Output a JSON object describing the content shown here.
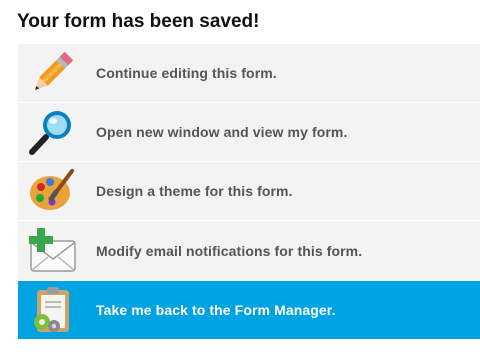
{
  "page": {
    "title": "Your form has been saved!"
  },
  "menu": {
    "items": [
      {
        "label": "Continue editing this form.",
        "icon": "pencil-icon"
      },
      {
        "label": "Open new window and view my form.",
        "icon": "magnifier-icon"
      },
      {
        "label": "Design a theme for this form.",
        "icon": "paint-palette-icon"
      },
      {
        "label": "Modify email notifications for this form.",
        "icon": "email-add-icon"
      },
      {
        "label": "Take me back to the Form Manager.",
        "icon": "clipboard-gears-icon",
        "selected": true
      }
    ]
  },
  "colors": {
    "accent": "#00a3e2",
    "item_bg": "#f3f3f3",
    "label_text": "#555555",
    "title_text": "#111111"
  }
}
